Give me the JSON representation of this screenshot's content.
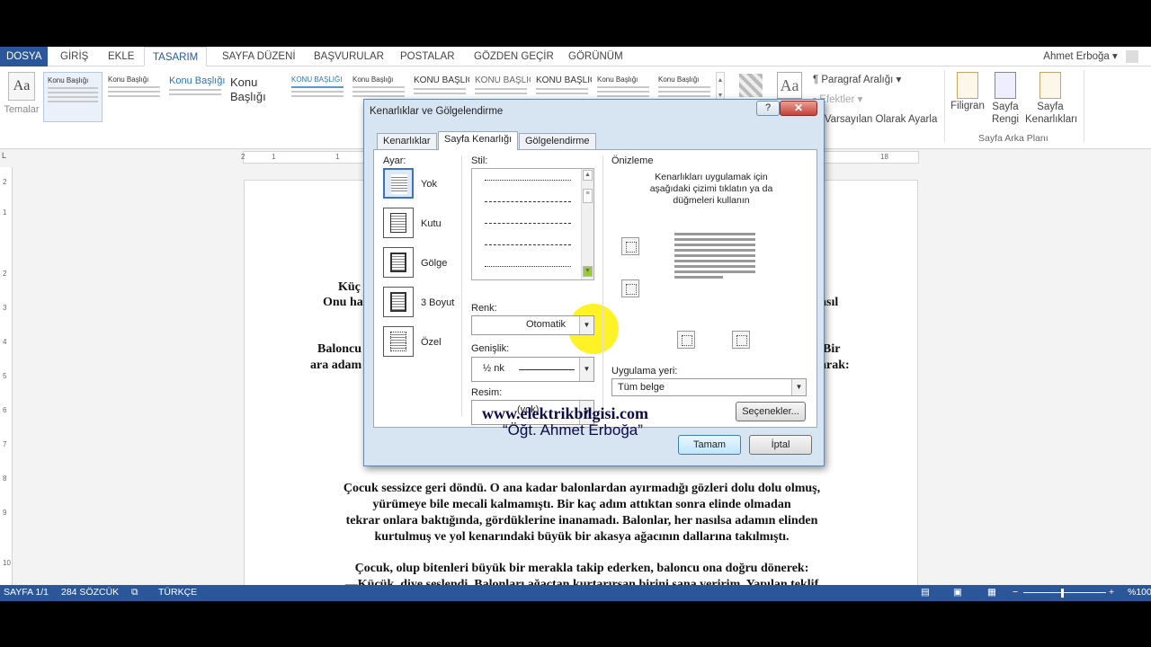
{
  "tabs": [
    "DOSYA",
    "GİRİŞ",
    "EKLE",
    "TASARIM",
    "SAYFA DÜZENİ",
    "BAŞVURULAR",
    "POSTALAR",
    "GÖZDEN GEÇİR",
    "GÖRÜNÜM"
  ],
  "user_name": "Ahmet Erboğa",
  "ribbon": {
    "themes_label": "Temalar",
    "gallery": [
      "Konu Başlığı",
      "Konu Başlığı",
      "Konu Başlığı",
      "Konu Başlığı",
      "KONU BAŞLIĞI",
      "Konu Başlığı",
      "KONU BAŞLIĞI",
      "KONU BAŞLIĞI",
      "KONU BAŞLIĞI",
      "Konu Başlığı",
      "Konu Başlığı"
    ],
    "paragraph_spacing": "Paragraf Aralığı",
    "effects": "Efektler",
    "set_default": "Varsayılan Olarak Ayarla",
    "watermark": "Filigran",
    "page_color": "Sayfa Rengi",
    "page_borders": "Sayfa Kenarlıkları",
    "group_page_background": "Sayfa Arka Planı"
  },
  "ruler_h": [
    "2",
    "1",
    "1",
    "2",
    "18"
  ],
  "ruler_v": [
    "2",
    "1",
    "2",
    "3",
    "4",
    "5",
    "6",
    "7",
    "8",
    "9",
    "10"
  ],
  "document": {
    "line1_a": "Küç",
    "line1_b": "ı.",
    "line2_a": "Onu ha",
    "line2_b": "asıl",
    "line3_a": "Baloncu",
    "line3_b": ". Bir",
    "line4_a": "ara adam",
    "line4_b": "yarak:",
    "para1": [
      "Çocuk sessizce geri döndü. O ana kadar balonlardan ayırmadığı gözleri dolu dolu olmuş,",
      "yürümeye bile mecali kalmamıştı. Bir kaç adım attıktan sonra elinde olmadan",
      "tekrar onlara baktığında, gördüklerine inanamadı. Balonlar, her nasılsa adamın elinden",
      "kurtulmuş ve yol kenarındaki büyük bir akasya ağacının dallarına takılmıştı."
    ],
    "para2": [
      "Çocuk, olup bitenleri büyük bir merakla takip ederken, baloncu ona doğru dönerek:",
      "—Küçük, diye seslendi. Balonları ağaçtan kurtarırsan birini sana veririm. Yapılan teklif"
    ]
  },
  "status": {
    "page": "SAYFA 1/1",
    "words": "284 SÖZCÜK",
    "language": "TÜRKÇE",
    "zoom": "%100"
  },
  "dialog": {
    "title": "Kenarlıklar ve Gölgelendirme",
    "help": "?",
    "close": "✕",
    "tabs": [
      "Kenarlıklar",
      "Sayfa Kenarlığı",
      "Gölgelendirme"
    ],
    "setting_label": "Ayar:",
    "settings": [
      "Yok",
      "Kutu",
      "Gölge",
      "3 Boyut",
      "Özel"
    ],
    "style_label": "Stil:",
    "color_label": "Renk:",
    "color_value": "Otomatik",
    "width_label": "Genişlik:",
    "width_value": "½ nk",
    "art_label": "Resim:",
    "art_value": "(yok)",
    "preview_label": "Önizleme",
    "preview_hint": [
      "Kenarlıkları uygulamak için",
      "aşağıdaki çizimi tıklatın ya da",
      "düğmeleri kullanın"
    ],
    "apply_label": "Uygulama yeri:",
    "apply_value": "Tüm belge",
    "options_button": "Seçenekler...",
    "ok_button": "Tamam",
    "cancel_button": "İptal"
  },
  "watermark_overlay": {
    "site": "www.elektrikbilgisi.com",
    "author": "“Öğt. Ahmet Erboğa”"
  }
}
